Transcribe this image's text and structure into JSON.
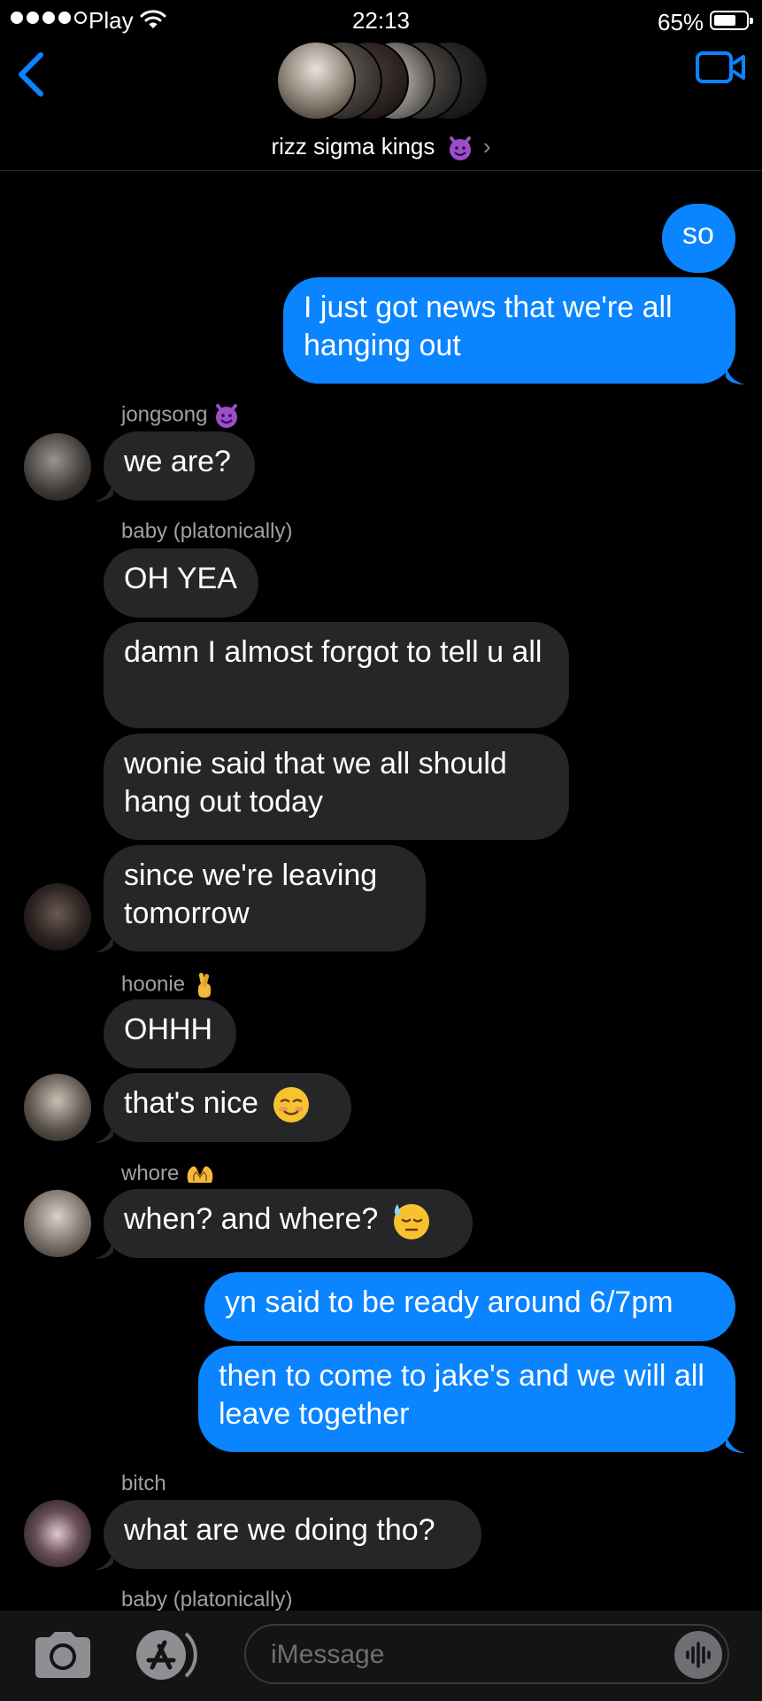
{
  "status_bar": {
    "carrier": "Play",
    "time": "22:13",
    "battery": "65%"
  },
  "header": {
    "group_name": "rizz sigma kings",
    "group_emoji_icon": "smiling-devil-icon"
  },
  "messages": [
    {
      "type": "sent",
      "text": "so"
    },
    {
      "type": "sent",
      "text": "I just got news that we're all hanging out"
    },
    {
      "type": "sender",
      "name": "jongsong"
    },
    {
      "type": "received",
      "text": "we are?"
    },
    {
      "type": "sender",
      "name": "baby (platonically)"
    },
    {
      "type": "received",
      "text": "OH YEA"
    },
    {
      "type": "received",
      "text": "damn I almost forgot to tell u all"
    },
    {
      "type": "received",
      "text": "wonie said that we all should hang out today"
    },
    {
      "type": "received",
      "text": "since we're leaving tomorrow"
    },
    {
      "type": "sender",
      "name": "hoonie"
    },
    {
      "type": "received",
      "text": "OHHH"
    },
    {
      "type": "received",
      "text": "that's nice"
    },
    {
      "type": "sender",
      "name": "whore"
    },
    {
      "type": "received",
      "text": "when? and where?"
    },
    {
      "type": "sent",
      "text": "yn said to be ready around 6/7pm"
    },
    {
      "type": "sent",
      "text": "then to come to jake's and we will all leave together"
    },
    {
      "type": "sender",
      "name": "bitch"
    },
    {
      "type": "received",
      "text": "what are we doing tho?"
    },
    {
      "type": "sender",
      "name": "baby (platonically)"
    }
  ],
  "composer": {
    "placeholder": "iMessage"
  },
  "colors": {
    "sent": "#0a84ff",
    "received": "#262628",
    "background": "#000000",
    "accent": "#0a84ff"
  }
}
